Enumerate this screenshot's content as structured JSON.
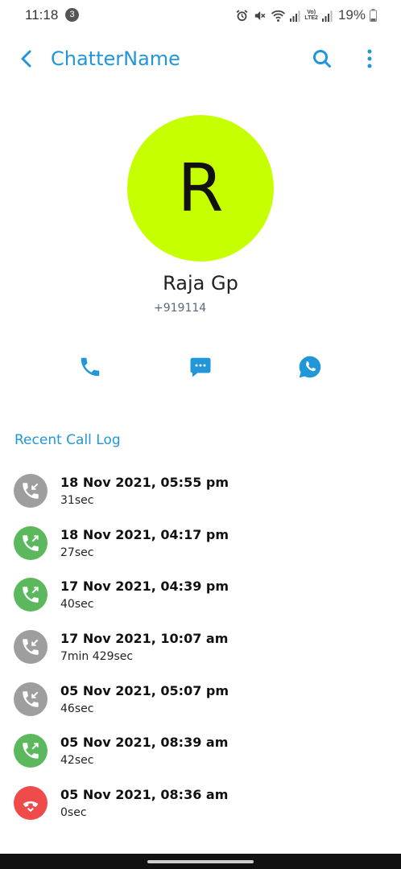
{
  "status_bar": {
    "time": "11:18",
    "notification_count": "3",
    "network_label_top": "Vo)",
    "network_label_bottom": "LTE2",
    "battery": "19%"
  },
  "app_bar": {
    "title": "ChatterName",
    "back_icon": "back-arrow-icon",
    "search_icon": "search-icon",
    "more_icon": "more-vert-icon"
  },
  "contact": {
    "initial": "R",
    "name": "Raja Gp",
    "phone": "+919114",
    "avatar_color": "#c6ff00"
  },
  "actions": [
    {
      "name": "call",
      "icon": "phone-icon"
    },
    {
      "name": "message",
      "icon": "chat-bubble-icon"
    },
    {
      "name": "whatsapp",
      "icon": "whatsapp-icon"
    }
  ],
  "recent_calls": {
    "title": "Recent Call Log",
    "items": [
      {
        "date": "18 Nov 2021, 05:55 pm",
        "duration": "31sec",
        "type": "incoming",
        "color": "#9e9e9e"
      },
      {
        "date": "18 Nov 2021, 04:17 pm",
        "duration": "27sec",
        "type": "outgoing",
        "color": "#5cb85c"
      },
      {
        "date": "17 Nov 2021, 04:39 pm",
        "duration": "40sec",
        "type": "outgoing",
        "color": "#5cb85c"
      },
      {
        "date": "17 Nov 2021, 10:07 am",
        "duration": "7min 429sec",
        "type": "incoming",
        "color": "#9e9e9e"
      },
      {
        "date": "05 Nov 2021, 05:07 pm",
        "duration": "46sec",
        "type": "incoming",
        "color": "#9e9e9e"
      },
      {
        "date": "05 Nov 2021, 08:39 am",
        "duration": "42sec",
        "type": "outgoing",
        "color": "#5cb85c"
      },
      {
        "date": "05 Nov 2021, 08:36 am",
        "duration": "0sec",
        "type": "missed",
        "color": "#ef4b4b"
      }
    ]
  },
  "colors": {
    "accent": "#2196d9",
    "incoming": "#9e9e9e",
    "outgoing": "#5cb85c",
    "missed": "#ef4b4b"
  }
}
